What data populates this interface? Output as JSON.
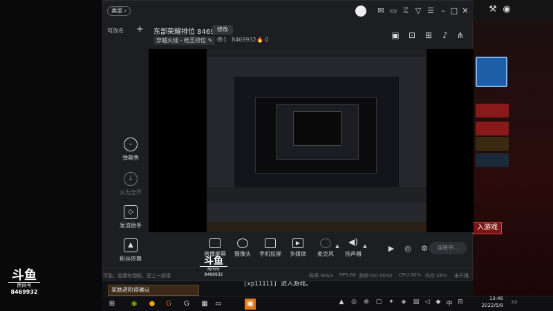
{
  "window": {
    "type_button": "类型",
    "room_title": "东部荣耀排位 8469932",
    "edit_label": "修改",
    "category": "穿越火线 - 枪王排位",
    "viewers": "1",
    "room_id_small": "8469932",
    "fire_count": "0"
  },
  "sidebar": {
    "title": "可改名",
    "add": "+",
    "items": [
      {
        "label": "弹幕秀",
        "icon": "danmaku-icon"
      },
      {
        "label": "火力全开",
        "icon": "download-icon"
      },
      {
        "label": "发流助手",
        "icon": "cube-icon"
      },
      {
        "label": "粉丝依舞",
        "icon": "mask-icon"
      }
    ]
  },
  "toolbar": {
    "items": [
      {
        "label": "直播屏幕",
        "icon": "screen-icon"
      },
      {
        "label": "摄像头",
        "icon": "camera-icon"
      },
      {
        "label": "手机投屏",
        "icon": "phone-cast-icon"
      },
      {
        "label": "多媒体",
        "icon": "media-icon"
      },
      {
        "label": "麦克风",
        "icon": "mic-icon"
      },
      {
        "label": "扬声器",
        "icon": "speaker-icon"
      }
    ],
    "start_label": "连接中..."
  },
  "statusbar": {
    "left": "可能，直播有烟叙，更上一层楼",
    "rate": "码率:0kb/s",
    "fps": "FPS:60",
    "drop": "丢帧:0(0.00%)",
    "cpu": "CPU:30%",
    "mem": "内存:28%",
    "live": "未开播"
  },
  "logo": {
    "main": "斗鱼",
    "sub": "房间号",
    "id": "8469932"
  },
  "game": {
    "chat_line": "[xp11111] 进入游戏。",
    "enter_game": "入游戏",
    "popup": "奖励进阶得确认"
  },
  "taskbar": {
    "time": "13:46",
    "date": "2022/5/8",
    "lang": "中"
  },
  "colors": {
    "app_bg": "#1d1e22",
    "accent_red": "#7b1414"
  }
}
